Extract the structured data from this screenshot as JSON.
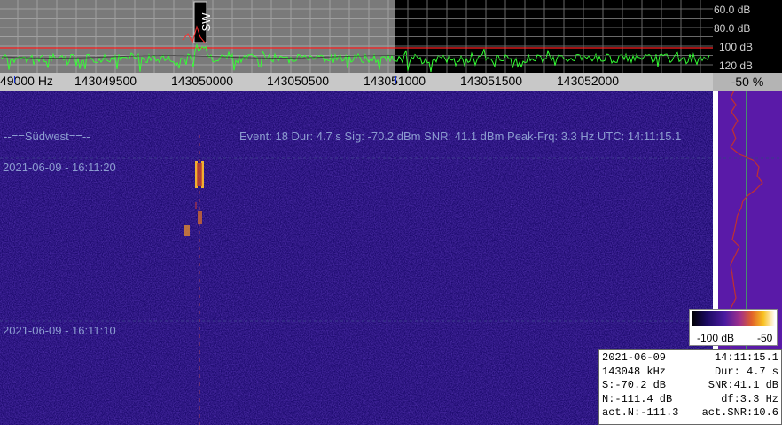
{
  "spectrum": {
    "db_labels": [
      "60.0 dB",
      "80.0 dB",
      "100 dB",
      "120 dB"
    ],
    "marker_label": "SW"
  },
  "freq_axis": {
    "labels": [
      "49000 Hz",
      "143049500",
      "143050000",
      "143050500",
      "143051000",
      "143051500",
      "143052000"
    ]
  },
  "percent": "-50 %",
  "waterfall": {
    "station": "--==Südwest==--",
    "event_line": "Event: 18   Dur: 4.7 s   Sig: -70.2 dBm   SNR: 41.1 dBm   Peak-Frq: 3.3 Hz   UTC: 14:11:15.1",
    "ts1": "2021-06-09  -  16:11:20",
    "ts2": "2021-06-09  -  16:11:10"
  },
  "colorbar": {
    "min_label": "-100 dB",
    "max_label": "-50"
  },
  "info": {
    "date": "2021-06-09",
    "time": "14:11:15.1",
    "freq": "143048 kHz",
    "dur": "Dur: 4.7 s",
    "sig": "S:-70.2 dB",
    "snr": "SNR:41.1 dB",
    "noise": "N:-111.4 dB",
    "df": "df:3.3 Hz",
    "act_n": "act.N:-111.3",
    "act_snr": "act.SNR:10.6"
  },
  "colors": {
    "spectrum_green": "#33ff33",
    "threshold_red": "#ff2020",
    "waterfall_bg": "#1c0a6e"
  }
}
